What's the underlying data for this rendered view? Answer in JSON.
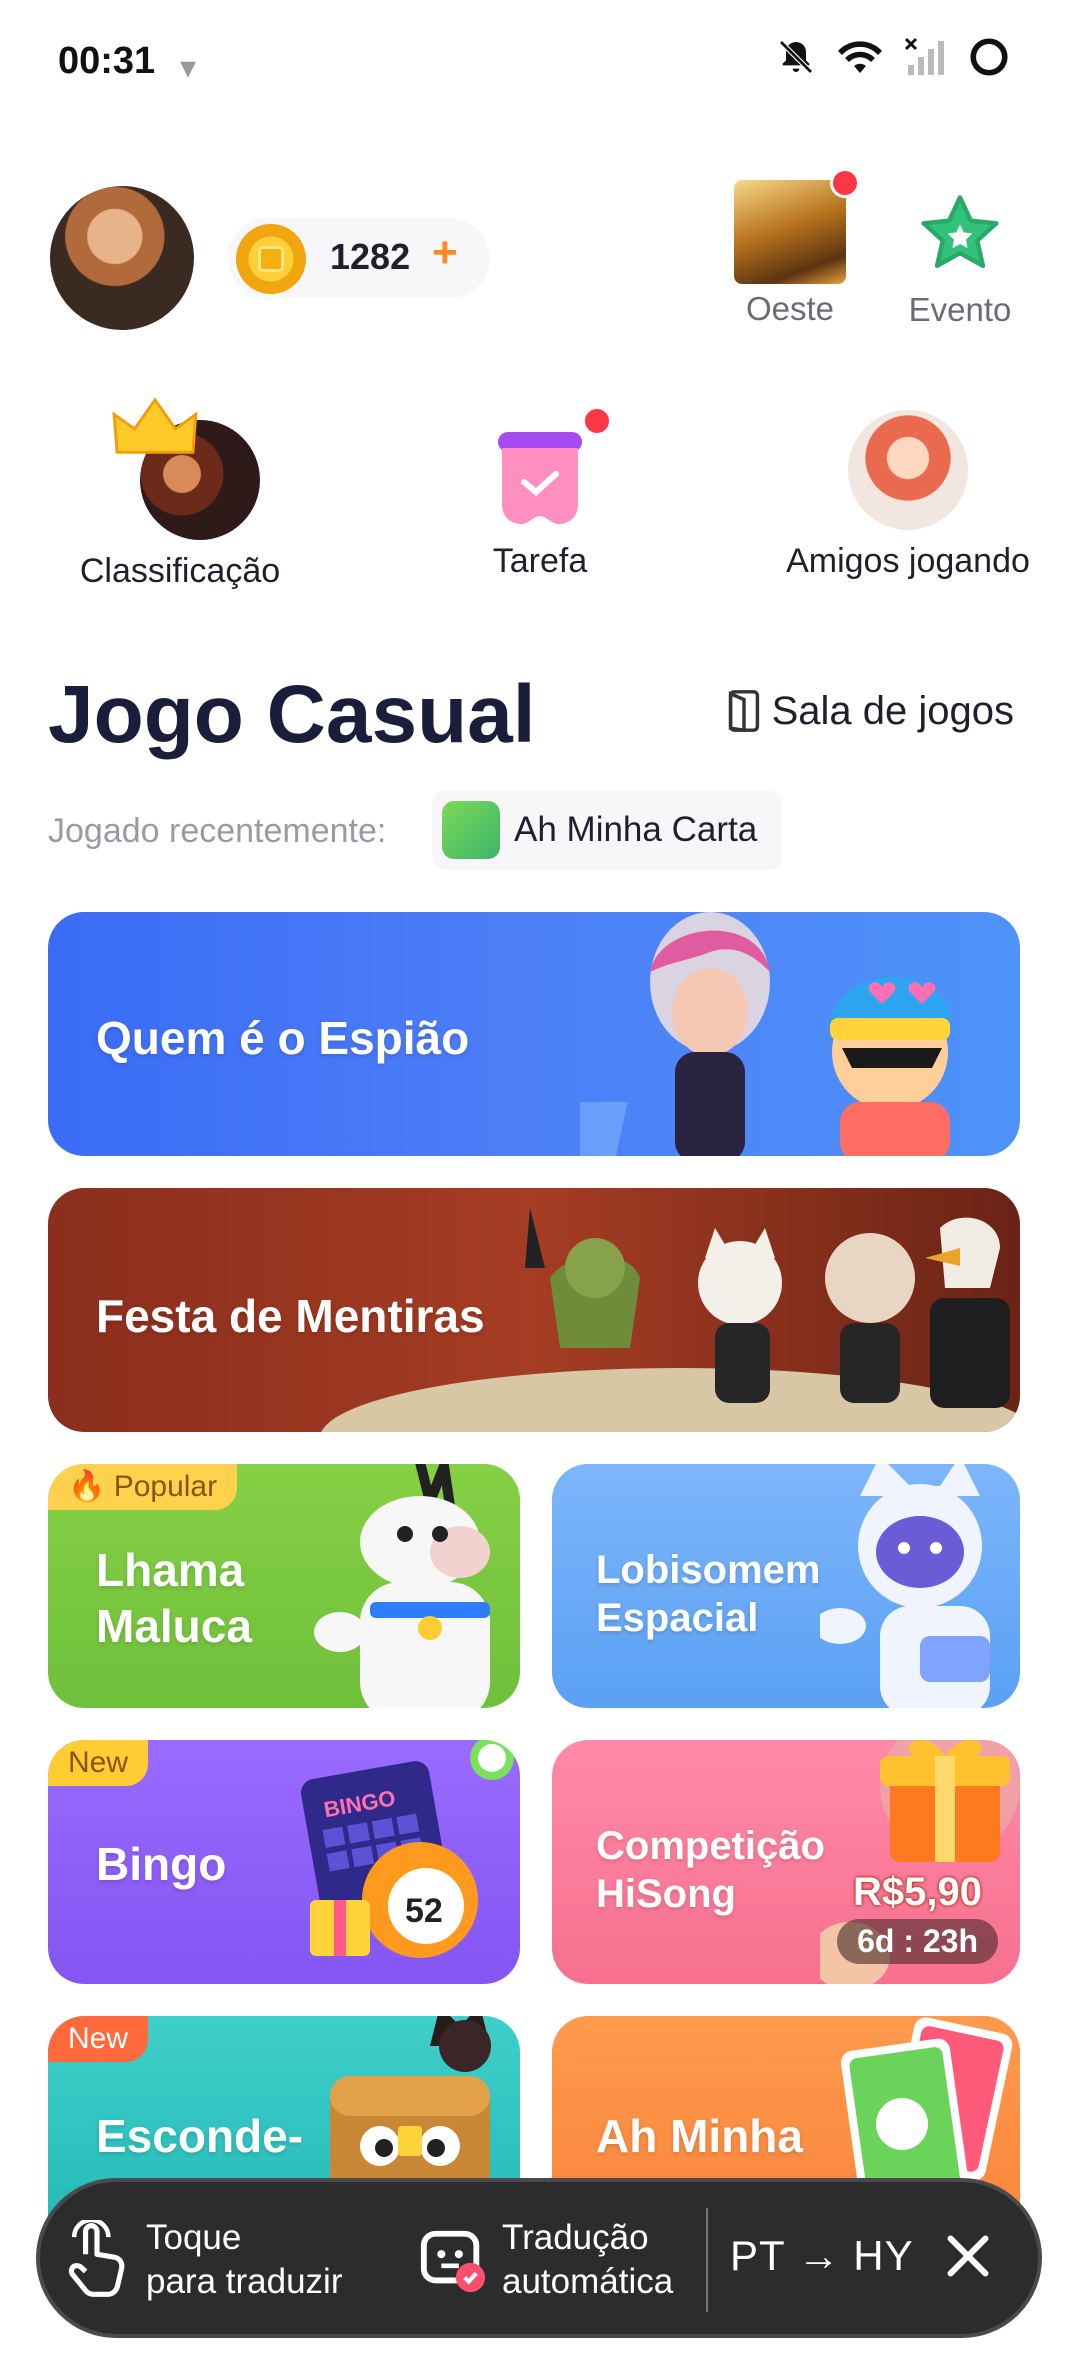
{
  "status_bar": {
    "time": "00:31",
    "icons": [
      "cup-icon",
      "bell-off-icon",
      "wifi-icon",
      "signal-icon",
      "battery-ring-icon"
    ]
  },
  "profile": {
    "coins": "1282",
    "coin_plus": "+",
    "top_links": [
      {
        "label": "Oeste",
        "icon": "oeste-game-icon"
      },
      {
        "label": "Evento",
        "icon": "star-icon"
      }
    ]
  },
  "shortcuts": [
    {
      "label": "Classificação"
    },
    {
      "label": "Tarefa"
    },
    {
      "label": "Amigos jogando"
    }
  ],
  "section": {
    "title": "Jogo Casual",
    "room_link": "Sala de jogos",
    "recent_label": "Jogado recentemente:",
    "recent_game": "Ah Minha Carta"
  },
  "games": {
    "spy": {
      "title": "Quem é o Espião"
    },
    "lies": {
      "title": "Festa de Mentiras"
    },
    "lhama": {
      "title_line1": "Lhama",
      "title_line2": "Maluca",
      "badge": "Popular"
    },
    "lobisomem": {
      "title_line1": "Lobisomem",
      "title_line2": "Espacial"
    },
    "bingo": {
      "title": "Bingo",
      "badge": "New"
    },
    "hisong": {
      "title_line1": "Competição",
      "title_line2": "HiSong",
      "prize": "R$5,90",
      "timer": "6d : 23h"
    },
    "esconde": {
      "title": "Esconde-",
      "badge": "New"
    },
    "ahminha": {
      "title": "Ah Minha"
    }
  },
  "translate_bar": {
    "tap_line1": "Toque",
    "tap_line2": "para traduzir",
    "auto_line1": "Tradução",
    "auto_line2": "automática",
    "lang_from": "PT",
    "arrow": "→",
    "lang_to": "HY"
  },
  "colors": {
    "accent_orange": "#ff8a1f",
    "notification_red": "#ff3646",
    "title_navy": "#1b1e3a"
  }
}
